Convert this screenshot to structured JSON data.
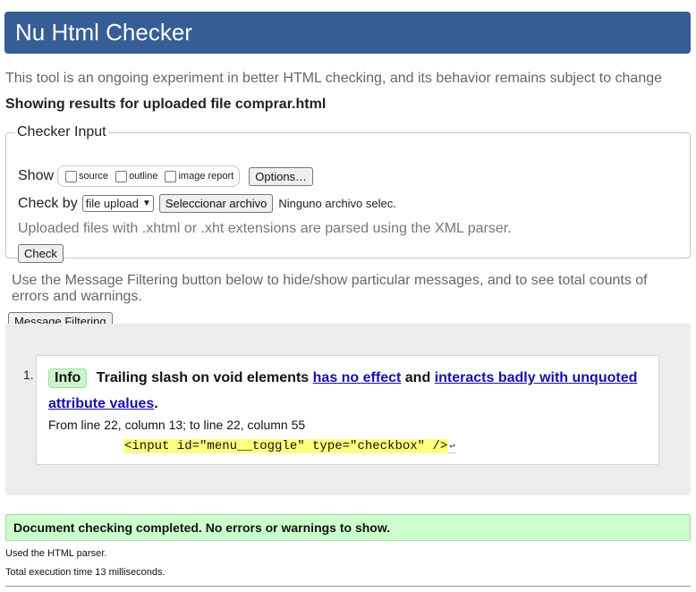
{
  "header": {
    "title": "Nu Html Checker"
  },
  "intro": "This tool is an ongoing experiment in better HTML checking, and its behavior remains subject to change",
  "showing": "Showing results for uploaded file comprar.html",
  "checker": {
    "legend": "Checker Input",
    "show_label": "Show",
    "show_options": [
      "source",
      "outline",
      "image report"
    ],
    "options_button": "Options…",
    "check_by_label": "Check by",
    "check_by_value": "file upload",
    "file_button": "Seleccionar archivo",
    "no_file": "Ninguno archivo selec.",
    "xml_note": "Uploaded files with .xhtml or .xht extensions are parsed using the XML parser.",
    "check_button": "Check"
  },
  "filter": {
    "intro": "Use the Message Filtering button below to hide/show particular messages, and to see total counts of errors and warnings.",
    "button": "Message Filtering"
  },
  "messages": [
    {
      "number": "1.",
      "type": "Info",
      "text_before": "Trailing slash on void elements",
      "link1": "has no effect",
      "text_mid": "and",
      "link2": "interacts badly with unquoted attribute values",
      "text_end": ".",
      "location": "From line 22, column 13; to line 22, column 55",
      "code": "<input id=\"menu__toggle\" type=\"checkbox\" />",
      "line_end_glyph": "↩"
    }
  ],
  "result": "Document checking completed. No errors or warnings to show.",
  "footer": {
    "parser": "Used the HTML parser.",
    "time": "Total execution time 13 milliseconds."
  },
  "colors": {
    "header_bg": "#365d95",
    "info_badge": "#ccf5cc",
    "success_bg": "#ccffcc",
    "code_highlight": "#ffff80",
    "link": "#1a0dab"
  }
}
